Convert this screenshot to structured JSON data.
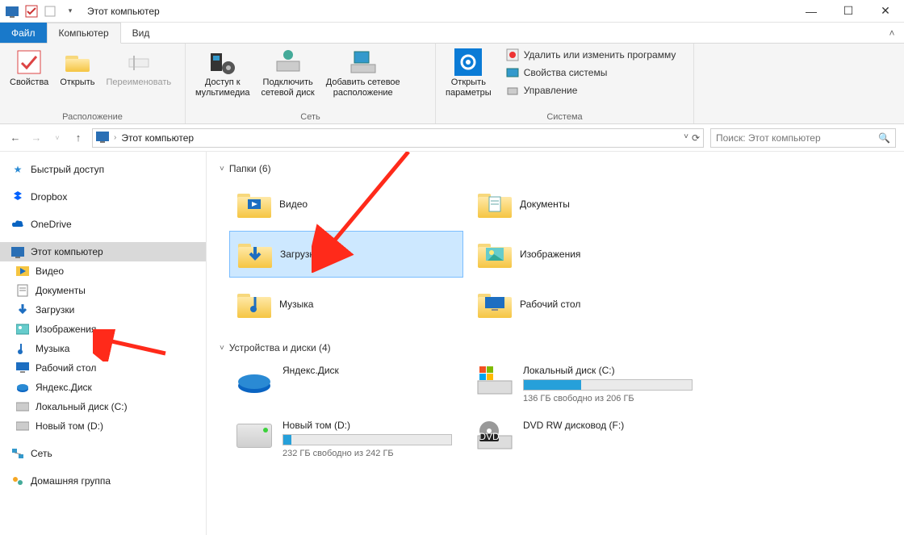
{
  "window": {
    "title": "Этот компьютер"
  },
  "tabs": {
    "file": "Файл",
    "computer": "Компьютер",
    "view": "Вид"
  },
  "ribbon": {
    "location": {
      "properties": "Свойства",
      "open": "Открыть",
      "rename": "Переименовать",
      "caption": "Расположение"
    },
    "network": {
      "mediaAccess": "Доступ к\nмультимедиа",
      "mapDrive": "Подключить\nсетевой диск",
      "addNetLoc": "Добавить сетевое\nрасположение",
      "caption": "Сеть"
    },
    "system": {
      "openSettings": "Открыть\nпараметры",
      "uninstall": "Удалить или изменить программу",
      "sysprops": "Свойства системы",
      "manage": "Управление",
      "caption": "Система"
    }
  },
  "address": {
    "root": "Этот компьютер"
  },
  "search": {
    "placeholder": "Поиск: Этот компьютер"
  },
  "sidebar": {
    "quickAccess": "Быстрый доступ",
    "dropbox": "Dropbox",
    "onedrive": "OneDrive",
    "thisPC": "Этот компьютер",
    "videos": "Видео",
    "documents": "Документы",
    "downloads": "Загрузки",
    "pictures": "Изображения",
    "music": "Музыка",
    "desktop": "Рабочий стол",
    "yandexDisk": "Яндекс.Диск",
    "localDiskC": "Локальный диск (C:)",
    "newVolD": "Новый том (D:)",
    "network": "Сеть",
    "homegroup": "Домашняя группа"
  },
  "sections": {
    "folders": "Папки (6)",
    "drives": "Устройства и диски (4)"
  },
  "folders": {
    "videos": "Видео",
    "documents": "Документы",
    "downloads": "Загрузки",
    "pictures": "Изображения",
    "music": "Музыка",
    "desktop": "Рабочий стол"
  },
  "drives": {
    "yandex": {
      "name": "Яндекс.Диск"
    },
    "c": {
      "name": "Локальный диск (C:)",
      "free": "136 ГБ свободно из 206 ГБ",
      "fillPct": 34
    },
    "d": {
      "name": "Новый том (D:)",
      "free": "232 ГБ свободно из 242 ГБ",
      "fillPct": 5
    },
    "dvd": {
      "name": "DVD RW дисковод (F:)"
    }
  }
}
